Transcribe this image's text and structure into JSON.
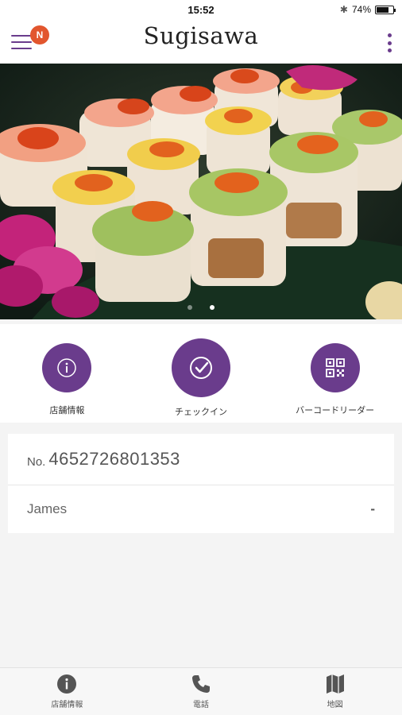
{
  "status_bar": {
    "time": "15:52",
    "battery_percent": "74%",
    "battery_level": 0.74
  },
  "header": {
    "title": "Sugisawa",
    "notification_badge": "N",
    "menu_icon": "hamburger-icon",
    "overflow_icon": "vertical-dots-icon"
  },
  "carousel": {
    "page_count": 2,
    "active_index": 1
  },
  "actions": [
    {
      "label": "店舗情報",
      "icon": "info-icon"
    },
    {
      "label": "チェックイン",
      "icon": "checkmark-icon"
    },
    {
      "label": "バーコードリーダー",
      "icon": "qr-code-icon"
    }
  ],
  "member": {
    "number_prefix": "No.",
    "number": "4652726801353",
    "name": "James",
    "name_suffix": "-"
  },
  "bottom_nav": [
    {
      "label": "店舗情報",
      "icon": "info-icon"
    },
    {
      "label": "電話",
      "icon": "phone-icon"
    },
    {
      "label": "地図",
      "icon": "map-icon"
    }
  ],
  "colors": {
    "accent": "#6a3c8c",
    "badge": "#e2562e"
  }
}
